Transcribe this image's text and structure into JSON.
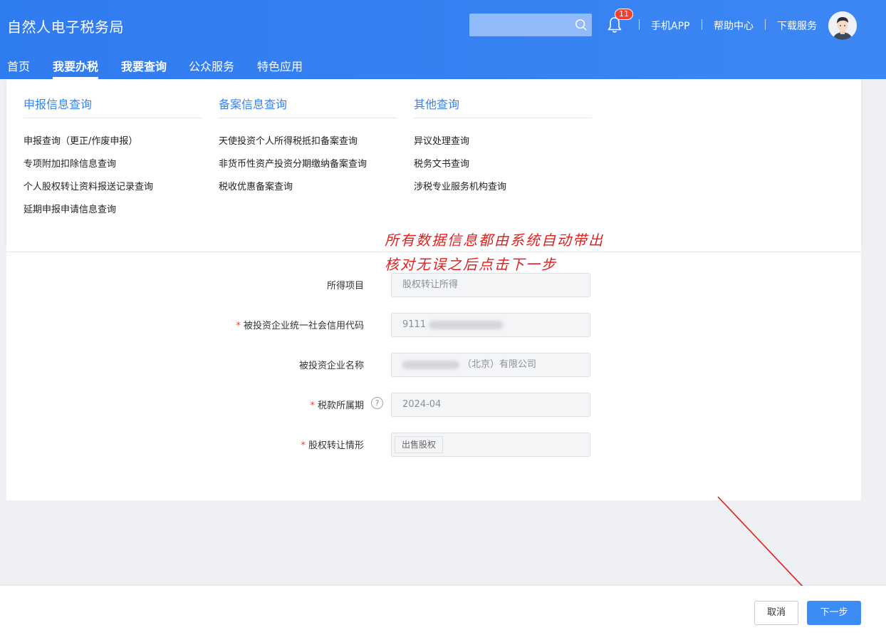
{
  "header": {
    "brand": "自然人电子税务局",
    "notification_count": "11",
    "links": [
      "手机APP",
      "帮助中心",
      "下载服务"
    ]
  },
  "nav": [
    "首页",
    "我要办税",
    "我要查询",
    "公众服务",
    "特色应用"
  ],
  "menu": {
    "columns": [
      {
        "title": "申报信息查询",
        "items": [
          "申报查询（更正/作废申报）",
          "专项附加扣除信息查询",
          "个人股权转让资料报送记录查询",
          "延期申报申请信息查询"
        ]
      },
      {
        "title": "备案信息查询",
        "items": [
          "天使投资个人所得税抵扣备案查询",
          "非货币性资产投资分期缴纳备案查询",
          "税收优惠备案查询"
        ]
      },
      {
        "title": "其他查询",
        "items": [
          "异议处理查询",
          "税务文书查询",
          "涉税专业服务机构查询"
        ]
      }
    ]
  },
  "form": {
    "income_item": {
      "label": "所得项目",
      "value": "股权转让所得"
    },
    "credit_code": {
      "label": "被投资企业统一社会信用代码",
      "value": "9111"
    },
    "company_name": {
      "label": "被投资企业名称",
      "value": "（北京）有限公司"
    },
    "tax_period": {
      "label": "税款所属期",
      "value": "2024-04"
    },
    "transfer_type": {
      "label": "股权转让情形",
      "value": "出售股权"
    }
  },
  "annotation": {
    "line1": "所有数据信息都由系统自动带出",
    "line2": "核对无误之后点击下一步",
    "color": "#e02020"
  },
  "footer": {
    "cancel": "取消",
    "next": "下一步"
  },
  "colors": {
    "brand": "#2f7bf0",
    "accent": "#3a84e6",
    "required": "#f04134"
  }
}
